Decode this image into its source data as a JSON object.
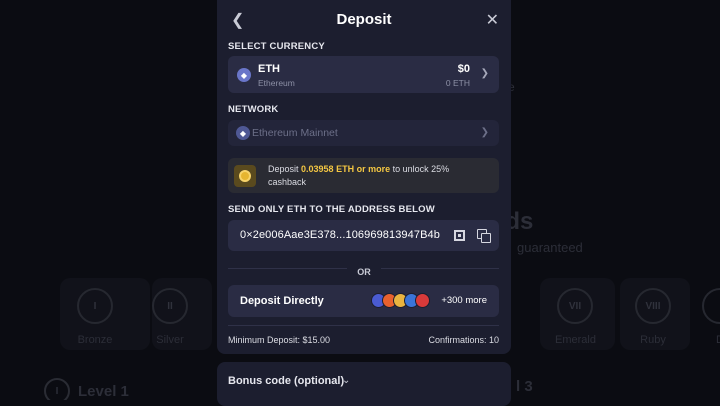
{
  "background": {
    "heading": "rds",
    "subtext": "guaranteed",
    "side_text": "e",
    "tiers": [
      {
        "numeral": "I",
        "name": "Bronze"
      },
      {
        "numeral": "II",
        "name": "Silver"
      },
      {
        "numeral": "VII",
        "name": "Emerald"
      },
      {
        "numeral": "VIII",
        "name": "Ruby"
      },
      {
        "numeral": "",
        "name": "D"
      }
    ],
    "levels": [
      {
        "numeral": "I",
        "label": "Level 1"
      },
      {
        "numeral": "",
        "label": "l 3"
      }
    ]
  },
  "modal": {
    "title": "Deposit",
    "back_icon": "chevron-left-icon",
    "close_icon": "close-icon",
    "select_currency_label": "SELECT CURRENCY",
    "currency": {
      "symbol": "ETH",
      "name": "Ethereum",
      "usd_value": "$0",
      "crypto_value": "0 ETH"
    },
    "network_label": "NETWORK",
    "network": {
      "name": "Ethereum Mainnet"
    },
    "promo": {
      "prefix": "Deposit",
      "amount": "0.03958 ETH or more",
      "suffix": "to unlock 25% cashback"
    },
    "send_label_prefix": "SEND ONLY",
    "send_label_currency": "ETH",
    "send_label_suffix": "TO THE ADDRESS BELOW",
    "address": "0×2e006Aae3E378...106969813947B4b",
    "or_text": "OR",
    "deposit_directly": {
      "label": "Deposit Directly",
      "more": "+300 more"
    },
    "min_deposit": "Minimum Deposit: $15.00",
    "confirmations": "Confirmations: 10"
  },
  "bonus": {
    "label": "Bonus code (optional)"
  },
  "colors": {
    "modal_bg": "#1c1e2f",
    "field_bg": "#2a2c44",
    "accent_gold": "#f4c742",
    "eth_purple": "#6a76c9"
  }
}
